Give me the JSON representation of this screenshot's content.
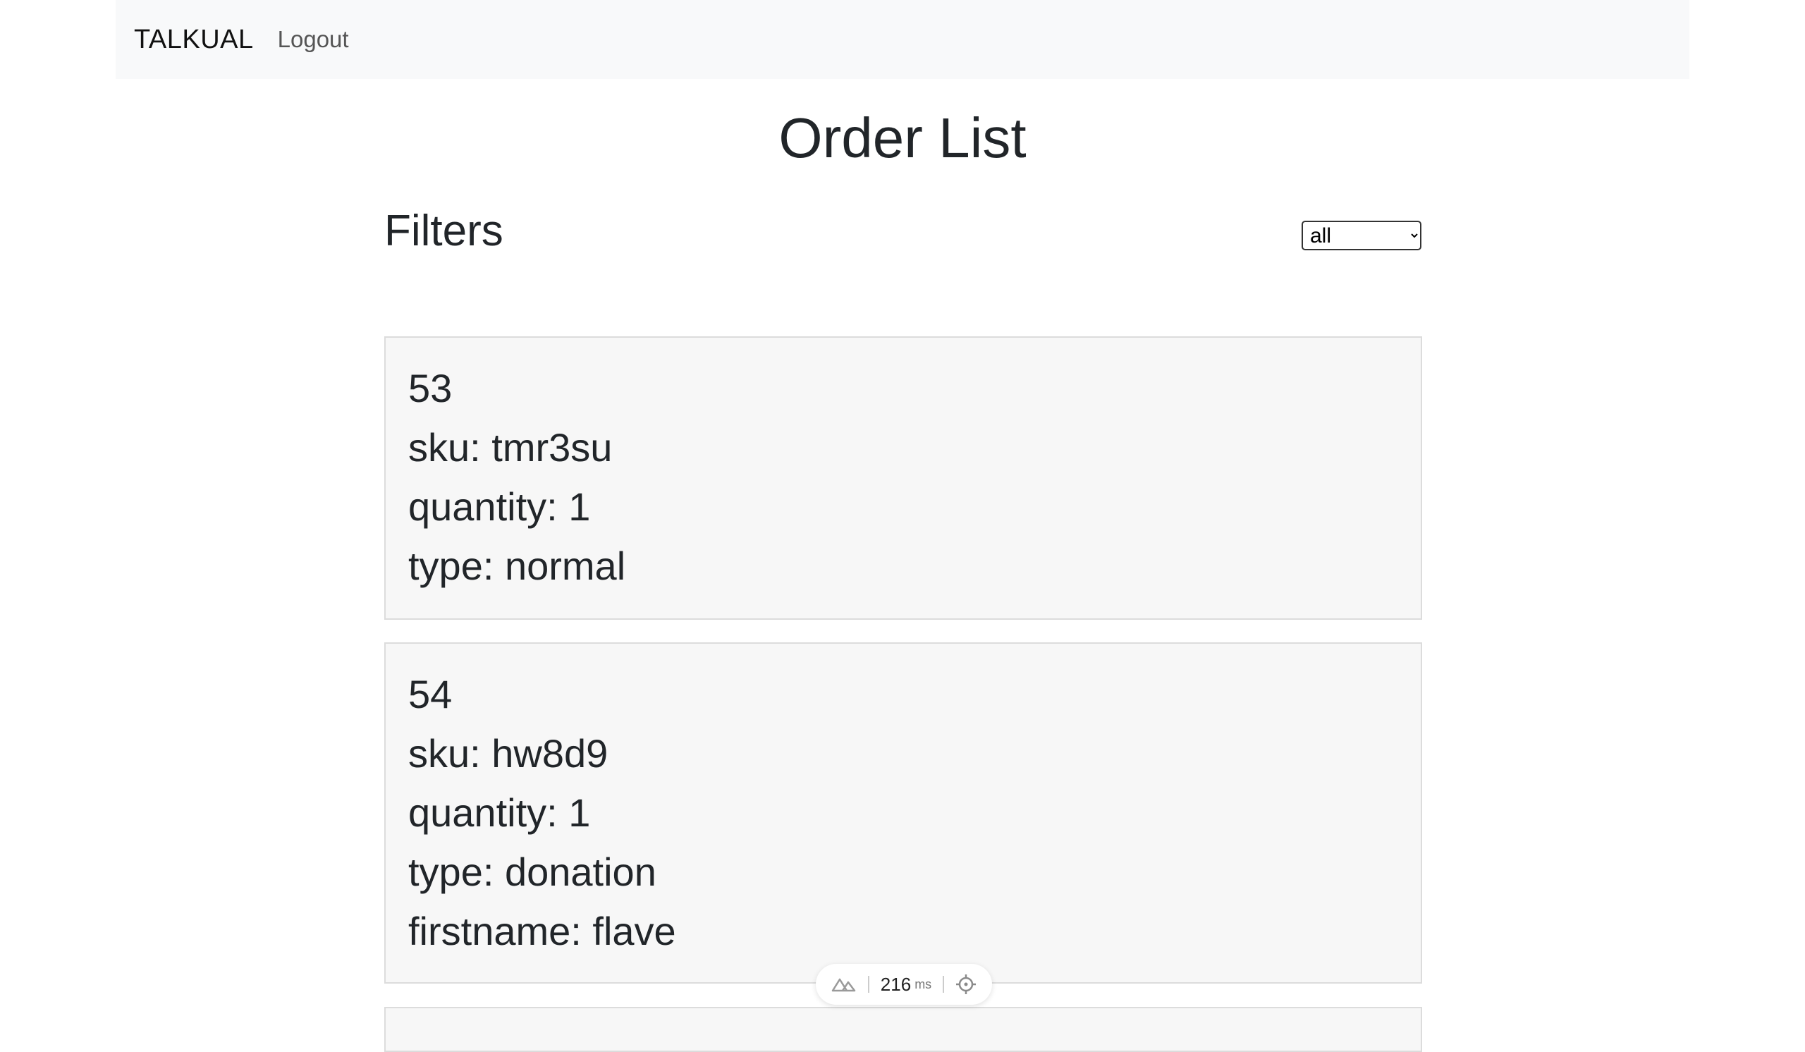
{
  "navbar": {
    "brand": "TALKUAL",
    "logout": "Logout"
  },
  "page": {
    "title": "Order List"
  },
  "filters": {
    "title": "Filters",
    "selected": "all"
  },
  "orders": [
    {
      "id": "53",
      "sku": "sku: tmr3su",
      "quantity": "quantity: 1",
      "type": "type: normal"
    },
    {
      "id": "54",
      "sku": "sku: hw8d9",
      "quantity": "quantity: 1",
      "type": "type: donation",
      "firstname": "firstname: flave"
    }
  ],
  "perf": {
    "value": "216",
    "unit": "ms"
  }
}
